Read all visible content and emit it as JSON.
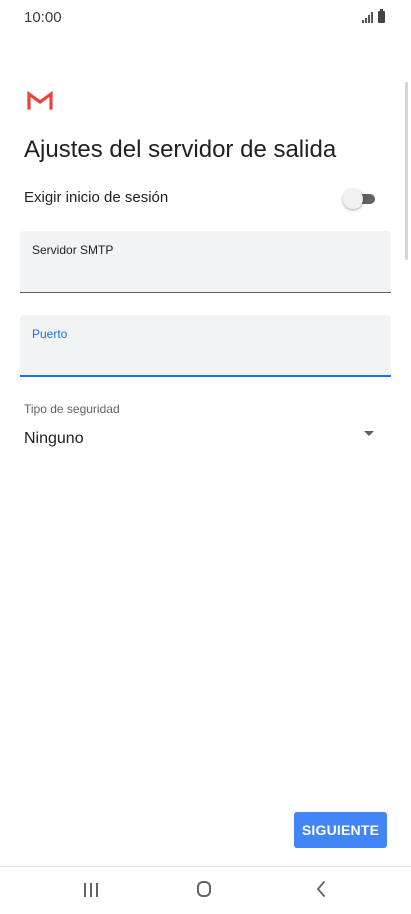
{
  "status_bar": {
    "time": "10:00",
    "signal_icon": "signal-bars-icon",
    "battery_icon": "battery-icon"
  },
  "app_icon": "gmail-icon",
  "colors": {
    "accent": "#1a73e8",
    "button": "#4285f4",
    "gmail_red": "#ea4335"
  },
  "title": "Ajustes del servidor de salida",
  "require_login": {
    "label": "Exigir inicio de sesión",
    "enabled": false
  },
  "smtp_server": {
    "label": "Servidor SMTP",
    "value": ""
  },
  "port": {
    "label": "Puerto",
    "value": ""
  },
  "security": {
    "label": "Tipo de seguridad",
    "selected": "Ninguno"
  },
  "next_button": {
    "label": "SIGUIENTE"
  },
  "nav": {
    "recent_icon": "recent-apps-icon",
    "home_icon": "home-icon",
    "back_icon": "back-icon"
  }
}
